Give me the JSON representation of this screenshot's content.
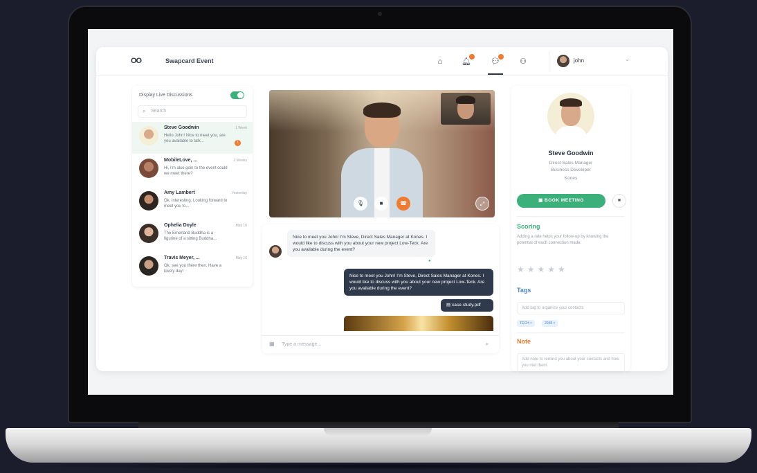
{
  "app": {
    "logo": "OO",
    "event_title": "Swapcard Event"
  },
  "topnav": {
    "items": [
      {
        "icon": "home-icon",
        "badge": false
      },
      {
        "icon": "bell-icon",
        "badge": true
      },
      {
        "icon": "chat-icon",
        "badge": true
      },
      {
        "icon": "people-icon",
        "badge": false
      }
    ],
    "user_name": "john"
  },
  "discussions": {
    "toggle_label": "Display Live Discussions",
    "toggle_on": true,
    "search_placeholder": "Search",
    "conversations": [
      {
        "name": "Steve Goodwin",
        "time": "1 Week",
        "preview": "Hello John! Nice to meet you, are you available to talk...",
        "badge": "1",
        "active": true
      },
      {
        "name": "MobileLove, ...",
        "time": "2 Weeks",
        "preview": "Hi, I'm also goin to the event could we meet there?",
        "badge": "",
        "active": false
      },
      {
        "name": "Amy Lambert",
        "time": "Yesterday",
        "preview": "Ok, interesting. Looking forward to meet you to...",
        "badge": "",
        "active": false
      },
      {
        "name": "Ophelia Doyle",
        "time": "May 16",
        "preview": "The Emerland Buddha is a figurine of a sitting Buddha...",
        "badge": "",
        "active": false
      },
      {
        "name": "Travis Meyer, ...",
        "time": "May 16",
        "preview": "Ok, see you there then. Have a lovely day!",
        "badge": "",
        "active": false
      }
    ]
  },
  "chat": {
    "incoming": "Nice to meet you John! I'm Steve, Direct Sales Manager at Kones. I would like to discuss with you about your new project Low-Teck. Are you available during the event?",
    "outgoing": "Nice to meet you John! I'm Steve, Direct Sales Manager at Kones. I would like to discuss with you about your new project Low-Teck. Are you available during the event?",
    "file_name": "case-study.pdf",
    "composer_placeholder": "Type a message..."
  },
  "profile": {
    "name": "Steve Goodwin",
    "role_1": "Direct Sales Manager",
    "role_2": "Business Developer",
    "company": "Kones",
    "book_label": "BOOK MEETING",
    "scoring_title": "Scoring",
    "scoring_desc": "Adding a rate helps your follow-up by knowing the potential of each connection made.",
    "stars": "★★★★★",
    "rating": 0,
    "tags_title": "Tags",
    "tags_placeholder": "Add tag to organize your contacts",
    "tags": [
      "TECH ×",
      "2048 ×"
    ],
    "note_title": "Note",
    "note_placeholder": "Add note to remind you about your contacts and how you met them."
  },
  "colors": {
    "accent_green": "#3bb07a",
    "accent_orange": "#f07b2f",
    "tag_blue": "#4f86c6",
    "dark_bubble": "#2f3a4c"
  }
}
